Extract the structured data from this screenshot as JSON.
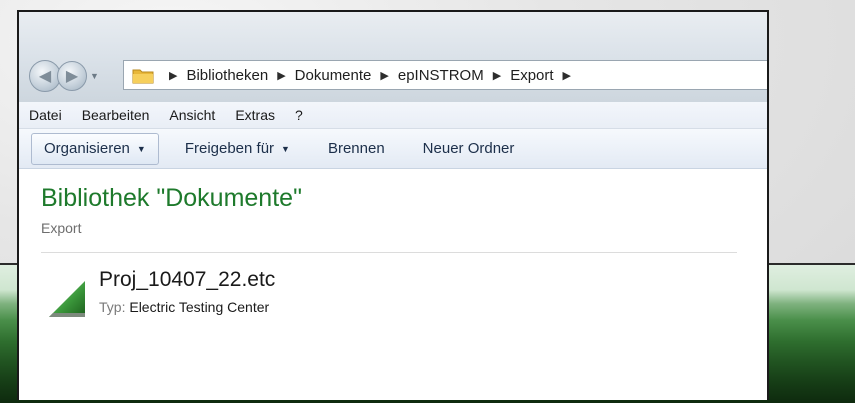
{
  "breadcrumb": [
    "Bibliotheken",
    "Dokumente",
    "epINSTROM",
    "Export"
  ],
  "menu": [
    "Datei",
    "Bearbeiten",
    "Ansicht",
    "Extras",
    "?"
  ],
  "toolbar": {
    "organize": "Organisieren",
    "share": "Freigeben für",
    "burn": "Brennen",
    "new_folder": "Neuer Ordner"
  },
  "library": {
    "title": "Bibliothek \"Dokumente\"",
    "subtitle": "Export"
  },
  "file": {
    "name": "Proj_10407_22.etc",
    "type_label": "Typ:",
    "type_value": "Electric Testing Center"
  },
  "colors": {
    "title_green": "#1e7a2c",
    "banner_green": "#2f6f2f"
  }
}
